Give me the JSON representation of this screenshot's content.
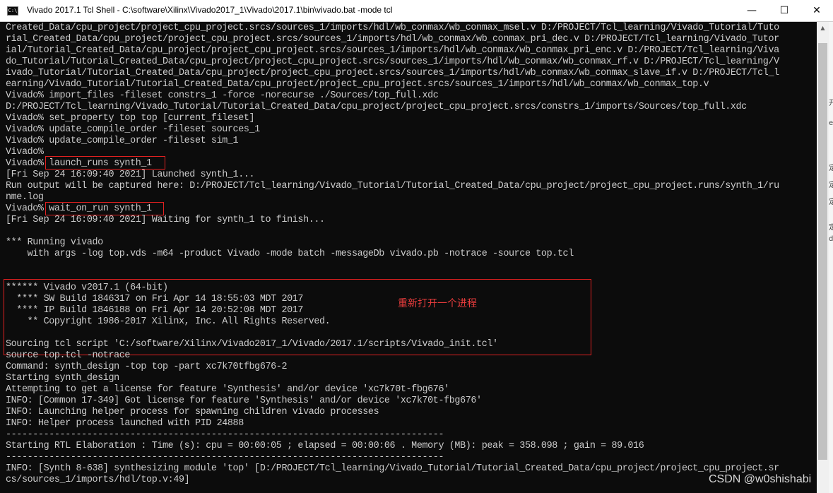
{
  "window": {
    "icon_label": "C:\\",
    "title": "Vivado 2017.1 Tcl Shell - C:\\software\\Xilinx\\Vivado2017_1\\Vivado\\2017.1\\bin\\vivado.bat  -mode tcl",
    "controls": {
      "minimize": "—",
      "maximize": "☐",
      "close": "✕"
    }
  },
  "console": {
    "lines": [
      "Created_Data/cpu_project/project_cpu_project.srcs/sources_1/imports/hdl/wb_conmax/wb_conmax_msel.v D:/PROJECT/Tcl_learning/Vivado_Tutorial/Tuto",
      "rial_Created_Data/cpu_project/project_cpu_project.srcs/sources_1/imports/hdl/wb_conmax/wb_conmax_pri_dec.v D:/PROJECT/Tcl_learning/Vivado_Tutor",
      "ial/Tutorial_Created_Data/cpu_project/project_cpu_project.srcs/sources_1/imports/hdl/wb_conmax/wb_conmax_pri_enc.v D:/PROJECT/Tcl_learning/Viva",
      "do_Tutorial/Tutorial_Created_Data/cpu_project/project_cpu_project.srcs/sources_1/imports/hdl/wb_conmax/wb_conmax_rf.v D:/PROJECT/Tcl_learning/V",
      "ivado_Tutorial/Tutorial_Created_Data/cpu_project/project_cpu_project.srcs/sources_1/imports/hdl/wb_conmax/wb_conmax_slave_if.v D:/PROJECT/Tcl_l",
      "earning/Vivado_Tutorial/Tutorial_Created_Data/cpu_project/project_cpu_project.srcs/sources_1/imports/hdl/wb_conmax/wb_conmax_top.v",
      "Vivado% import_files -fileset constrs_1 -force -norecurse ./Sources/top_full.xdc",
      "D:/PROJECT/Tcl_learning/Vivado_Tutorial/Tutorial_Created_Data/cpu_project/project_cpu_project.srcs/constrs_1/imports/Sources/top_full.xdc",
      "Vivado% set_property top top [current_fileset]",
      "Vivado% update_compile_order -fileset sources_1",
      "Vivado% update_compile_order -fileset sim_1",
      "Vivado%",
      "Vivado% launch_runs synth_1",
      "[Fri Sep 24 16:09:40 2021] Launched synth_1...",
      "Run output will be captured here: D:/PROJECT/Tcl_learning/Vivado_Tutorial/Tutorial_Created_Data/cpu_project/project_cpu_project.runs/synth_1/ru",
      "nme.log",
      "Vivado% wait_on_run synth_1",
      "[Fri Sep 24 16:09:40 2021] Waiting for synth_1 to finish...",
      "",
      "*** Running vivado",
      "    with args -log top.vds -m64 -product Vivado -mode batch -messageDb vivado.pb -notrace -source top.tcl",
      "",
      "",
      "****** Vivado v2017.1 (64-bit)",
      "  **** SW Build 1846317 on Fri Apr 14 18:55:03 MDT 2017",
      "  **** IP Build 1846188 on Fri Apr 14 20:52:08 MDT 2017",
      "    ** Copyright 1986-2017 Xilinx, Inc. All Rights Reserved.",
      "",
      "Sourcing tcl script 'C:/software/Xilinx/Vivado2017_1/Vivado/2017.1/scripts/Vivado_init.tcl'",
      "source top.tcl -notrace",
      "Command: synth_design -top top -part xc7k70tfbg676-2",
      "Starting synth_design",
      "Attempting to get a license for feature 'Synthesis' and/or device 'xc7k70t-fbg676'",
      "INFO: [Common 17-349] Got license for feature 'Synthesis' and/or device 'xc7k70t-fbg676'",
      "INFO: Launching helper process for spawning children vivado processes",
      "INFO: Helper process launched with PID 24888",
      "---------------------------------------------------------------------------------",
      "Starting RTL Elaboration : Time (s): cpu = 00:00:05 ; elapsed = 00:00:06 . Memory (MB): peak = 358.098 ; gain = 89.016",
      "---------------------------------------------------------------------------------",
      "INFO: [Synth 8-638] synthesizing module 'top' [D:/PROJECT/Tcl_learning/Vivado_Tutorial/Tutorial_Created_Data/cpu_project/project_cpu_project.sr",
      "cs/sources_1/imports/hdl/top.v:49]"
    ],
    "annotation": "重新打开一个进程"
  },
  "right_strip": [
    "开",
    "e",
    "定",
    "定",
    "定",
    "定",
    "do"
  ],
  "watermark": "CSDN @w0shishabi",
  "colors": {
    "console_bg": "#0c0c0c",
    "console_text": "#cccccc",
    "highlight": "#e02020",
    "annotation": "#e83c3c"
  }
}
